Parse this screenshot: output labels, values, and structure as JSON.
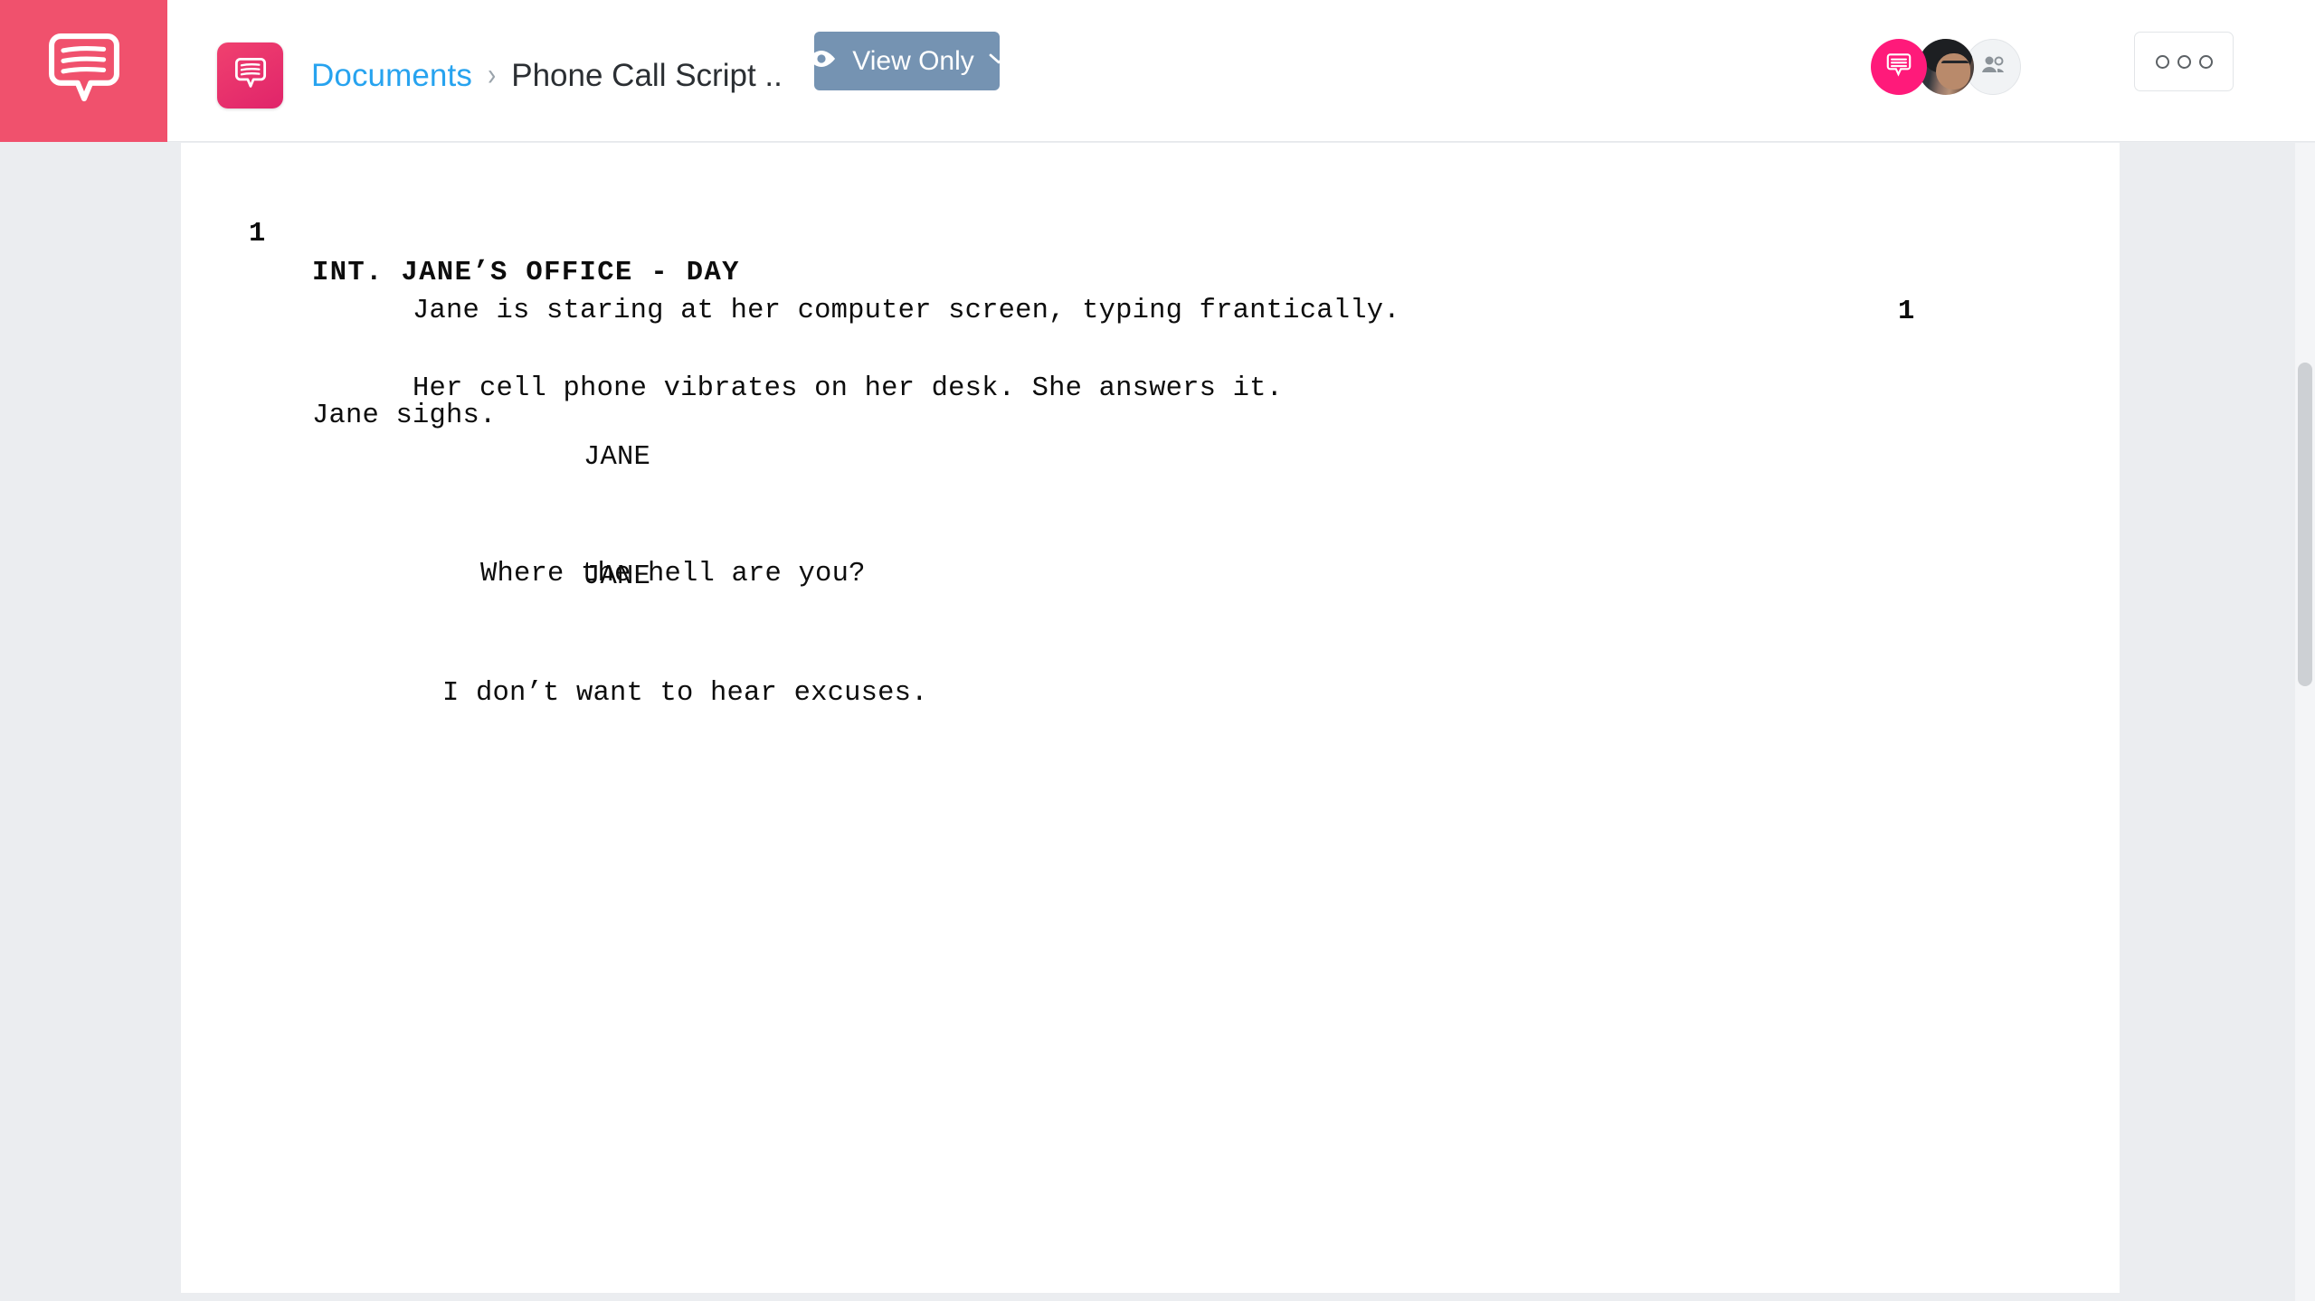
{
  "app": {
    "logo_icon": "speech-bubble-logo-icon",
    "brand_color": "#f0516d"
  },
  "topbar": {
    "doc_tile_icon": "speech-bubble-document-icon",
    "breadcrumb": {
      "parent_label": "Documents",
      "separator": "›",
      "current_label": "Phone Call Script .."
    },
    "view_mode_button": {
      "label": "View Only",
      "eye_icon": "eye-icon",
      "chevron_icon": "chevron-down-icon",
      "background": "#7593b2"
    },
    "avatars": {
      "chat_badge_icon": "chat-bubble-icon",
      "chat_badge_color": "#ff1a7a",
      "user_avatar": "user-photo-avatar",
      "invite_icon": "add-people-icon"
    },
    "more_button": {
      "icon": "three-dots-icon",
      "label": "ooo"
    }
  },
  "document": {
    "scene_number_left": "1",
    "scene_number_right": "1",
    "scene_heading": "INT. JANE’S OFFICE - DAY",
    "action_1": "Jane is staring at her computer screen, typing frantically.",
    "action_2": "Jane sighs.",
    "dialogue_blocks": [
      {
        "character": "JANE",
        "line": "Where the hell are you?"
      },
      {
        "character": "JANE",
        "line": "I don’t want to hear excuses."
      }
    ],
    "action_1_line2": "Her cell phone vibrates on her desk. She answers it."
  }
}
